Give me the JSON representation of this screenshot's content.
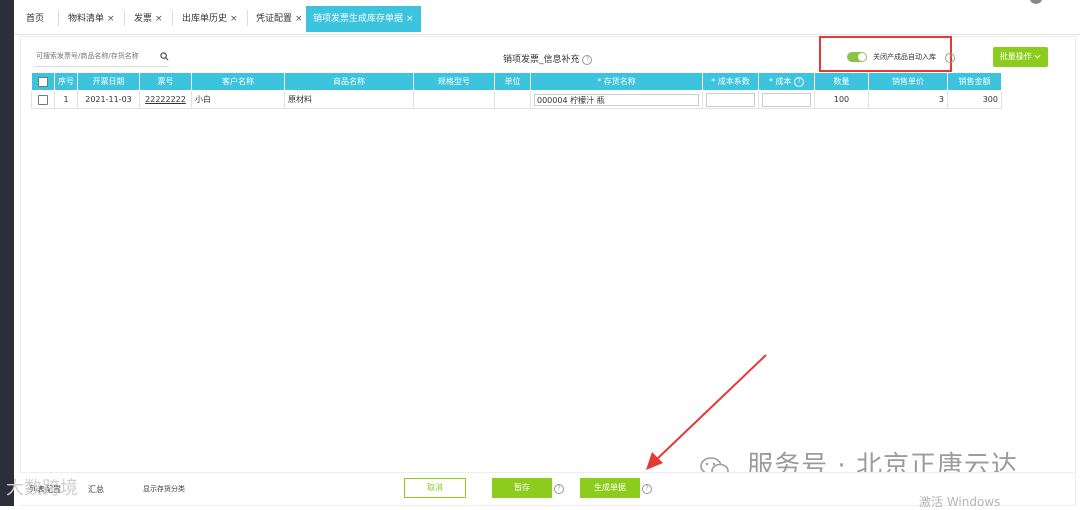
{
  "tabs": [
    {
      "label": "首页",
      "closable": false,
      "active": false
    },
    {
      "label": "物料清单",
      "closable": true,
      "active": false
    },
    {
      "label": "发票",
      "closable": true,
      "active": false
    },
    {
      "label": "出库单历史",
      "closable": true,
      "active": false
    },
    {
      "label": "凭证配置",
      "closable": true,
      "active": false
    },
    {
      "label": "销项发票生成库存单据",
      "closable": true,
      "active": true
    }
  ],
  "close_glyph": "×",
  "search": {
    "placeholder": "可搜索发票号/商品名称/存货名称"
  },
  "center_title": "销项发票_信息补充",
  "toggle": {
    "label": "关闭产成品自动入库",
    "on": true
  },
  "batch_button": "批量操作",
  "table": {
    "headers": [
      "序号",
      "开票日期",
      "票号",
      "客户名称",
      "商品名称",
      "规格型号",
      "单位",
      "* 存货名称",
      "* 成本系数",
      "* 成本",
      "数量",
      "销售单价",
      "销售金额"
    ],
    "rows": [
      {
        "index": "1",
        "date": "2021-11-03",
        "invoice_no": "22222222",
        "customer": "小白",
        "product": "原材料",
        "spec": "",
        "unit": "",
        "inventory": "000004 柠檬汁 瓶",
        "cost_ratio": "",
        "cost": "",
        "qty": "100",
        "price": "3",
        "amount": "300"
      }
    ]
  },
  "footer": {
    "list_config": "列表配置",
    "summary": "汇总",
    "show_category": "显示存货分类",
    "cancel": "取消",
    "save_draft": "暂存",
    "generate": "生成单据"
  },
  "watermark": {
    "text": "服务号 · 北京正唐云达",
    "overlay": "大数跨境"
  },
  "activate_windows": "激活 Windows",
  "colors": {
    "accent": "#3cc3dd",
    "green": "#8ccc1c",
    "red": "#e53935"
  }
}
